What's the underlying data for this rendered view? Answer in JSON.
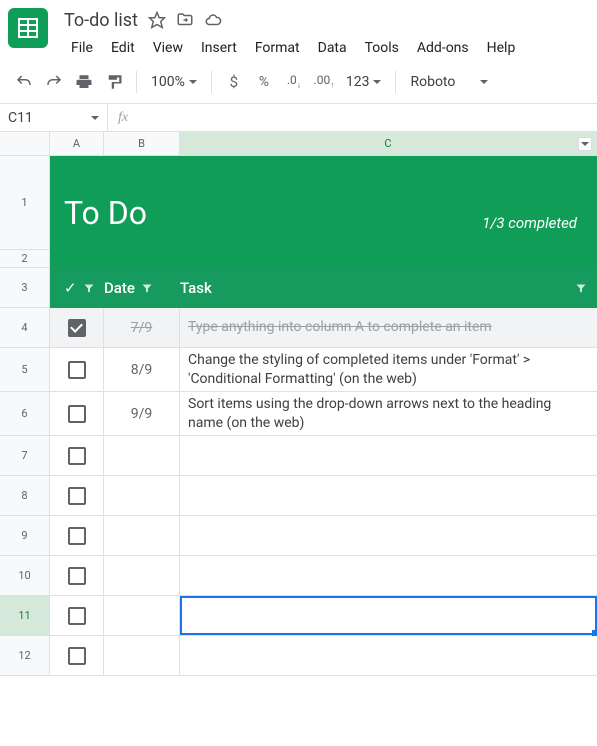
{
  "doc": {
    "title": "To-do list"
  },
  "menu": [
    "File",
    "Edit",
    "View",
    "Insert",
    "Format",
    "Data",
    "Tools",
    "Add-ons",
    "Help"
  ],
  "toolbar": {
    "zoom": "100%",
    "currency": "$",
    "percent": "%",
    "num_format": "123",
    "font": "Roboto"
  },
  "namebox": "C11",
  "columns": [
    "A",
    "B",
    "C"
  ],
  "sheet": {
    "title": "To Do",
    "completed": "1/3 completed",
    "headers": {
      "check": "✓",
      "date": "Date",
      "task": "Task"
    }
  },
  "rows": [
    {
      "n": 4,
      "done": true,
      "date": "7/9",
      "task": "Type anything into column A to complete an item",
      "h": "data-row"
    },
    {
      "n": 5,
      "done": false,
      "date": "8/9",
      "task": "Change the styling of completed items under 'Format' > 'Conditional Formatting' (on the web)",
      "h": "data-row med"
    },
    {
      "n": 6,
      "done": false,
      "date": "9/9",
      "task": "Sort items using the drop-down arrows next to the heading name (on the web)",
      "h": "data-row med"
    },
    {
      "n": 7,
      "done": false,
      "date": "",
      "task": "",
      "h": "data-row"
    },
    {
      "n": 8,
      "done": false,
      "date": "",
      "task": "",
      "h": "data-row"
    },
    {
      "n": 9,
      "done": false,
      "date": "",
      "task": "",
      "h": "data-row"
    },
    {
      "n": 10,
      "done": false,
      "date": "",
      "task": "",
      "h": "data-row"
    },
    {
      "n": 11,
      "done": false,
      "date": "",
      "task": "",
      "h": "data-row",
      "selected": true
    },
    {
      "n": 12,
      "done": false,
      "date": "",
      "task": "",
      "h": "data-row"
    }
  ]
}
